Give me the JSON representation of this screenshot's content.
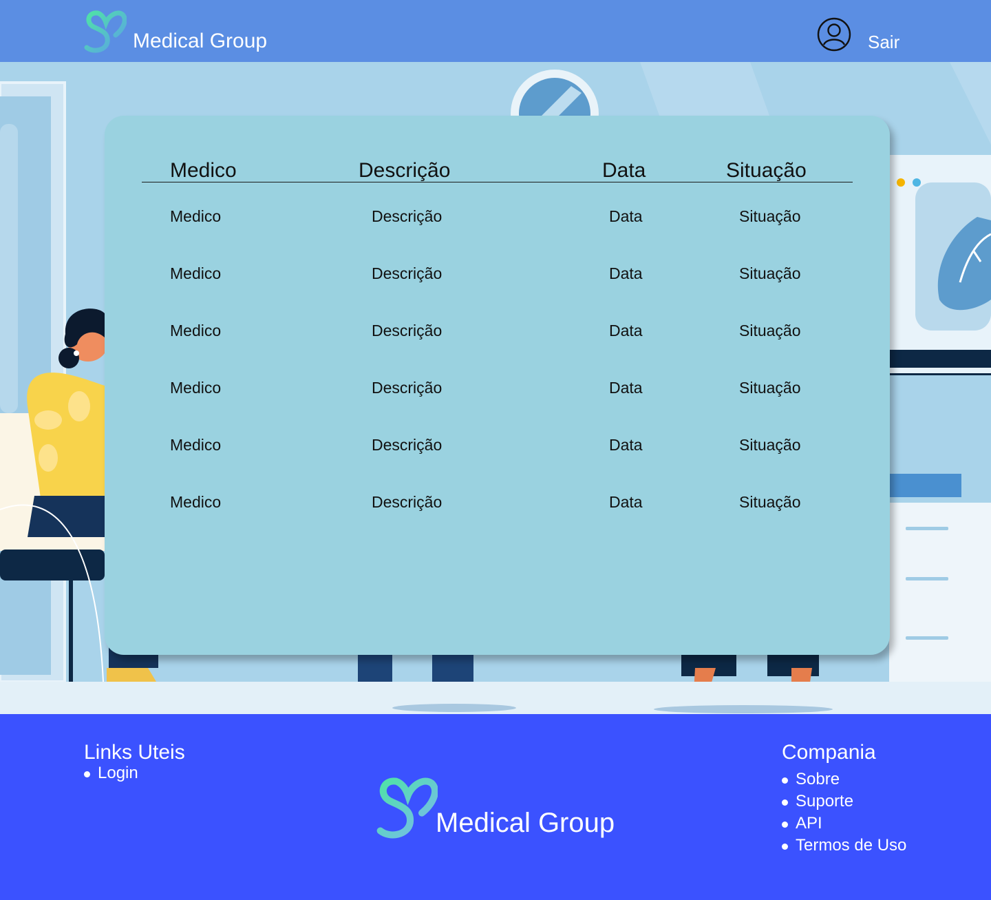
{
  "header": {
    "brand": "Medical Group",
    "logout_label": "Sair",
    "icons": {
      "logo": "heart-logo-icon",
      "user": "user-circle-icon"
    }
  },
  "table": {
    "columns": [
      "Medico",
      "Descrição",
      "Data",
      "Situação"
    ],
    "rows": [
      [
        "Medico",
        "Descrição",
        "Data",
        "Situação"
      ],
      [
        "Medico",
        "Descrição",
        "Data",
        "Situação"
      ],
      [
        "Medico",
        "Descrição",
        "Data",
        "Situação"
      ],
      [
        "Medico",
        "Descrição",
        "Data",
        "Situação"
      ],
      [
        "Medico",
        "Descrição",
        "Data",
        "Situação"
      ],
      [
        "Medico",
        "Descrição",
        "Data",
        "Situação"
      ]
    ]
  },
  "footer": {
    "links_title": "Links Uteis",
    "links": [
      "Login"
    ],
    "company_title": "Compania",
    "company_links": [
      "Sobre",
      "Suporte",
      "API",
      "Termos de Uso"
    ],
    "brand": "Medical Group"
  },
  "colors": {
    "header_bg": "#5b8ee3",
    "card_bg": "#9ad2e0",
    "footer_bg": "#3b52ff",
    "logo_gradient_start": "#4fd8a0",
    "logo_gradient_end": "#4f9ce0"
  }
}
